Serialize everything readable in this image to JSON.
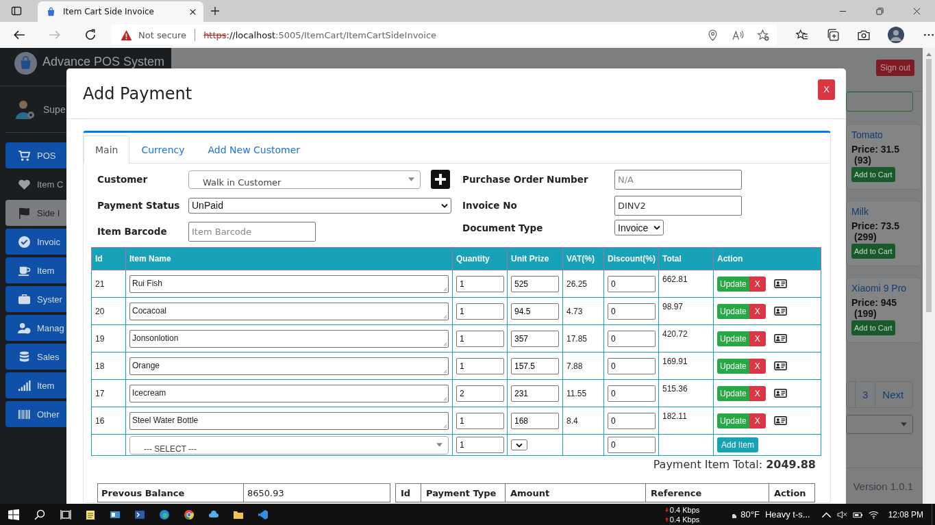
{
  "browser": {
    "tab_title": "Item Cart Side Invoice",
    "security": "Not secure",
    "url_scheme": "https",
    "url_host": "://localhost",
    "url_path": ":5005/ItemCart/ItemCartSideInvoice"
  },
  "app": {
    "brand": "Advance POS System",
    "user": "Supe",
    "sign_out": "Sign out",
    "version": "Version 1.0.1",
    "sidebar": [
      {
        "label": "POS",
        "kind": "button",
        "selected": false
      },
      {
        "label": "Item C",
        "kind": "plain",
        "selected": false
      },
      {
        "label": "Side I",
        "kind": "button",
        "selected": true
      },
      {
        "label": "Invoic",
        "kind": "button",
        "selected": false
      },
      {
        "label": "Item",
        "kind": "button",
        "selected": false
      },
      {
        "label": "Syster",
        "kind": "button",
        "selected": false
      },
      {
        "label": "Manag",
        "kind": "button",
        "selected": false
      },
      {
        "label": "Sales",
        "kind": "button",
        "selected": false
      },
      {
        "label": "Item",
        "kind": "button",
        "selected": false
      },
      {
        "label": "Other",
        "kind": "button",
        "selected": false
      }
    ],
    "products": [
      {
        "name": "Tomato",
        "price": "Price: 31.5",
        "stock": "(93)",
        "button": "Add to Cart"
      },
      {
        "name": "Milk",
        "price": "Price: 73.5",
        "stock": "(299)",
        "button": "Add to Cart"
      },
      {
        "name": "Xiaomi 9 Pro",
        "price": "Price: 945",
        "stock": "(199)",
        "button": "Add to Cart"
      }
    ],
    "pagination": [
      {
        "label": "3",
        "selected": false
      },
      {
        "label": "Next",
        "selected": false
      }
    ]
  },
  "modal": {
    "title": "Add Payment",
    "close": "X",
    "tabs": [
      {
        "label": "Main",
        "selected": true
      },
      {
        "label": "Currency",
        "selected": false
      },
      {
        "label": "Add New Customer",
        "selected": false
      }
    ],
    "customer": {
      "label": "Customer",
      "value": "Walk in Customer"
    },
    "payment_status": {
      "label": "Payment Status",
      "value": "UnPaid"
    },
    "item_barcode": {
      "label": "Item Barcode",
      "placeholder": "Item Barcode"
    },
    "purchase_order": {
      "label": "Purchase Order Number",
      "placeholder": "N/A"
    },
    "invoice_no": {
      "label": "Invoice No",
      "value": "DINV2"
    },
    "document_type": {
      "label": "Document Type",
      "value": "Invoice"
    },
    "table": {
      "columns": [
        "Id",
        "Item Name",
        "Quantity",
        "Unit Prize",
        "VAT(%)",
        "Discount(%)",
        "Total",
        "Action"
      ],
      "rows": [
        {
          "id": "21",
          "name": "Rui Fish",
          "quantity": "1",
          "unit_price": "525",
          "vat": "26.25",
          "discount": "0",
          "total": "662.81",
          "update": "Update",
          "remove": "X"
        },
        {
          "id": "20",
          "name": "Cocacoal",
          "quantity": "1",
          "unit_price": "94.5",
          "vat": "4.73",
          "discount": "0",
          "total": "98.97",
          "update": "Update",
          "remove": "X"
        },
        {
          "id": "19",
          "name": "Jonsonlotion",
          "quantity": "1",
          "unit_price": "357",
          "vat": "17.85",
          "discount": "0",
          "total": "420.72",
          "update": "Update",
          "remove": "X"
        },
        {
          "id": "18",
          "name": "Orange",
          "quantity": "1",
          "unit_price": "157.5",
          "vat": "7.88",
          "discount": "0",
          "total": "169.91",
          "update": "Update",
          "remove": "X"
        },
        {
          "id": "17",
          "name": "Icecream",
          "quantity": "2",
          "unit_price": "231",
          "vat": "11.55",
          "discount": "0",
          "total": "515.36",
          "update": "Update",
          "remove": "X"
        },
        {
          "id": "16",
          "name": "Steel Water Bottle",
          "quantity": "1",
          "unit_price": "168",
          "vat": "8.4",
          "discount": "0",
          "total": "182.11",
          "update": "Update",
          "remove": "X"
        }
      ],
      "new_row": {
        "item": "--- SELECT ---",
        "quantity": "1",
        "discount": "0",
        "add": "Add Item"
      }
    },
    "total": "Payment Item Total: **2049.88**",
    "balance": {
      "label": "Prevous Balance",
      "value": "8650.93"
    },
    "payments_columns": [
      "Id",
      "Payment Type",
      "Amount",
      "Reference",
      "Action"
    ]
  },
  "taskbar": {
    "net_down": "0.4 Kbps",
    "net_up": "0.4 Kbps",
    "temperature": "80°F",
    "weather": "Heavy t-s...",
    "time": "12:08 PM"
  }
}
